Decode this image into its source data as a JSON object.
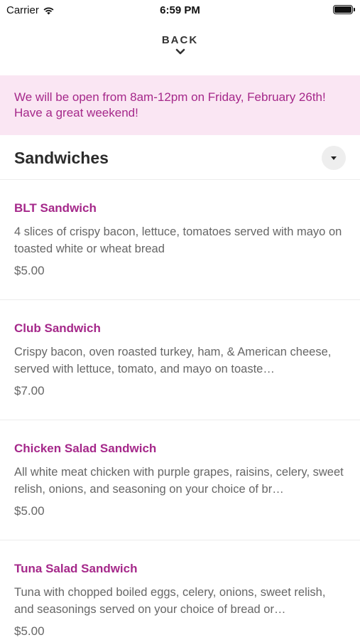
{
  "status_bar": {
    "carrier": "Carrier",
    "time": "6:59 PM"
  },
  "nav": {
    "back_label": "BACK"
  },
  "notice": {
    "text": "We will be open from 8am-12pm on Friday, February 26th! Have a great weekend!"
  },
  "section": {
    "title": "Sandwiches"
  },
  "items": [
    {
      "name": "BLT Sandwich",
      "description": "4 slices of crispy bacon, lettuce, tomatoes served with mayo on toasted white or wheat bread",
      "price": "$5.00"
    },
    {
      "name": "Club Sandwich",
      "description": "Crispy bacon, oven roasted turkey, ham, & American cheese, served with lettuce, tomato, and mayo on toaste…",
      "price": "$7.00"
    },
    {
      "name": "Chicken Salad Sandwich",
      "description": "All white meat chicken with purple grapes, raisins, celery, sweet relish, onions, and seasoning on your choice of br…",
      "price": "$5.00"
    },
    {
      "name": "Tuna Salad Sandwich",
      "description": "Tuna with chopped boiled eggs, celery, onions, sweet relish, and seasonings served on your choice of bread or…",
      "price": "$5.00"
    }
  ],
  "colors": {
    "accent": "#a5288a",
    "notice_bg": "#fae6f3"
  }
}
